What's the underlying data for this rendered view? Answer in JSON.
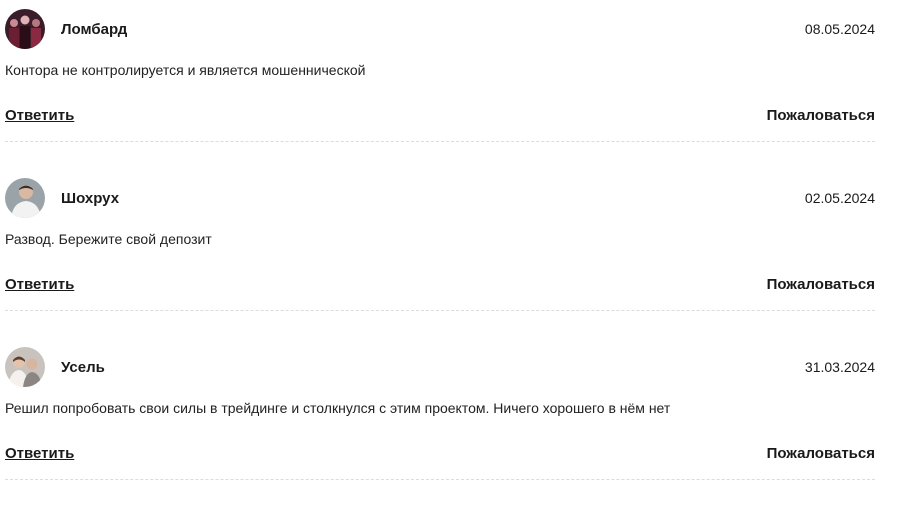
{
  "comments": [
    {
      "author": "Ломбард",
      "date": "08.05.2024",
      "text": "Контора не контролируется и является мошеннической",
      "reply_label": "Ответить",
      "report_label": "Пожаловаться"
    },
    {
      "author": "Шохрух",
      "date": "02.05.2024",
      "text": "Развод. Бережите свой депозит",
      "reply_label": "Ответить",
      "report_label": "Пожаловаться"
    },
    {
      "author": "Усель",
      "date": "31.03.2024",
      "text": "Решил попробовать свои силы в трейдинге и столкнулся с этим проектом. Ничего хорошего в нём нет",
      "reply_label": "Ответить",
      "report_label": "Пожаловаться"
    }
  ],
  "colors": {
    "text": "#1a1a1a",
    "divider": "#dcdcdc",
    "background": "#ffffff"
  }
}
